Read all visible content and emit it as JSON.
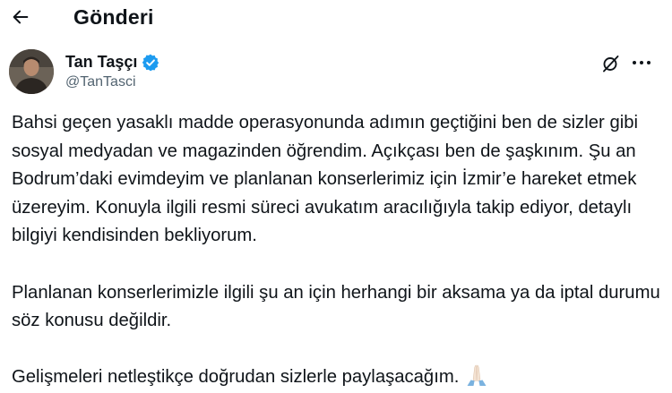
{
  "header": {
    "title": "Gönderi",
    "back_icon": "arrow-left-icon"
  },
  "tweet": {
    "author": {
      "name": "Tan Taşçı",
      "handle": "@TanTasci",
      "verified": true,
      "verified_color": "#1d9bf0"
    },
    "icons": {
      "grok": "grok-icon",
      "more": "more-horizontal-icon"
    },
    "paragraphs": [
      "Bahsi geçen yasaklı madde operasyonunda adımın geçtiğini ben de sizler gibi sosyal medyadan ve magazinden öğrendim. Açıkçası ben de şaşkınım. Şu an Bodrum’daki evimdeyim ve planlanan konserlerimiz için İzmir’e hareket etmek üzereyim. Konuyla ilgili resmi süreci avukatım aracılığıyla takip ediyor, detaylı bilgiyi kendisinden bekliyorum.",
      "Planlanan konserlerimizle ilgili şu an için herhangi bir aksama ya da iptal durumu söz konusu değildir.",
      "Gelişmeleri netleştikçe doğrudan sizlerle paylaşacağım."
    ],
    "trailing_emoji": "folded-hands-emoji"
  },
  "colors": {
    "text": "#0f1419",
    "secondary_text": "#536471",
    "accent": "#1d9bf0",
    "background": "#ffffff"
  }
}
